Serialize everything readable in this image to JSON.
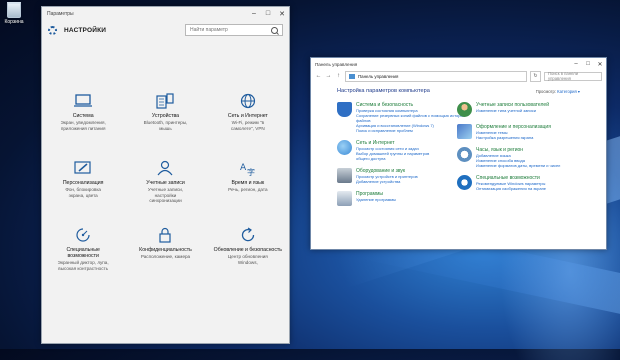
{
  "desktop": {
    "recycle_bin_label": "Корзина"
  },
  "settings_window": {
    "title": "Параметры",
    "heading": "НАСТРОЙКИ",
    "search_placeholder": "Найти параметр",
    "tiles": [
      {
        "icon": "laptop-icon",
        "title": "Система",
        "desc": "Экран, уведомления,\nприложения питания"
      },
      {
        "icon": "devices-icon",
        "title": "Устройства",
        "desc": "Bluetooth, принтеры,\nмышь"
      },
      {
        "icon": "globe-icon",
        "title": "Сеть и Интернет",
        "desc": "Wi-Fi, режим \"в\nсамолете\", VPN"
      },
      {
        "icon": "personalization-icon",
        "title": "Персонализация",
        "desc": "Фон, блокировка\nэкрана, цвета"
      },
      {
        "icon": "person-icon",
        "title": "Учетные записи",
        "desc": "Учетные записи,\nнастройки\nсинхронизации"
      },
      {
        "icon": "time-language-icon",
        "title": "Время и язык",
        "desc": "Речь, регион, дата"
      },
      {
        "icon": "accessibility-icon",
        "title": "Специальные\nвозможности",
        "desc": "Экранный диктор, лупа,\nвысокая контрастность"
      },
      {
        "icon": "lock-icon",
        "title": "Конфиденциальность",
        "desc": "Расположение, камера"
      },
      {
        "icon": "update-icon",
        "title": "Обновление и безопасность",
        "desc": "Центр обновления\nWindows,"
      }
    ]
  },
  "control_panel": {
    "title": "Панель управления",
    "address": "Панель управления",
    "search_placeholder": "Поиск в панели управления",
    "heading": "Настройка параметров компьютера",
    "view_by_label": "Просмотр:",
    "view_by_value": "Категория ▾",
    "left_categories": [
      {
        "icon": "security-shield-icon",
        "color": "#2f6fc4",
        "title": "Система и безопасность",
        "links": [
          "Проверка состояния компьютера",
          "Сохранение резервных копий файлов с помощью истории",
          "файлов",
          "Архивация и восстановление (Windows 7)",
          "Поиск и исправление проблем"
        ]
      },
      {
        "icon": "network-icon",
        "color": "#3b8ad6",
        "title": "Сеть и Интернет",
        "links": [
          "Просмотр состояния сети и задач",
          "Выбор домашней группы и параметров",
          "общего доступа"
        ]
      },
      {
        "icon": "hardware-sound-icon",
        "color": "#6a7a8c",
        "title": "Оборудование и звук",
        "links": [
          "Просмотр устройств и принтеров",
          "Добавление устройства"
        ]
      },
      {
        "icon": "programs-icon",
        "color": "#8da0b6",
        "title": "Программы",
        "links": [
          "Удаление программы"
        ]
      }
    ],
    "right_categories": [
      {
        "icon": "user-accounts-icon",
        "color": "#3f8f4a",
        "title": "Учетные записи пользователей",
        "links": [
          "Изменение типа учетной записи"
        ]
      },
      {
        "icon": "appearance-icon",
        "color": "#4a78c8",
        "title": "Оформление и персонализация",
        "links": [
          "Изменение темы",
          "Настройка разрешения экрана"
        ]
      },
      {
        "icon": "clock-region-icon",
        "color": "#5d8fc0",
        "title": "Часы, язык и регион",
        "links": [
          "Добавление языка",
          "Изменение способа ввода",
          "Изменение форматов даты, времени и чисел"
        ]
      },
      {
        "icon": "ease-of-access-icon",
        "color": "#1f6fbf",
        "title": "Специальные возможности",
        "links": [
          "Рекомендуемые Windows параметры",
          "Оптимизация изображения на экране"
        ]
      }
    ]
  }
}
